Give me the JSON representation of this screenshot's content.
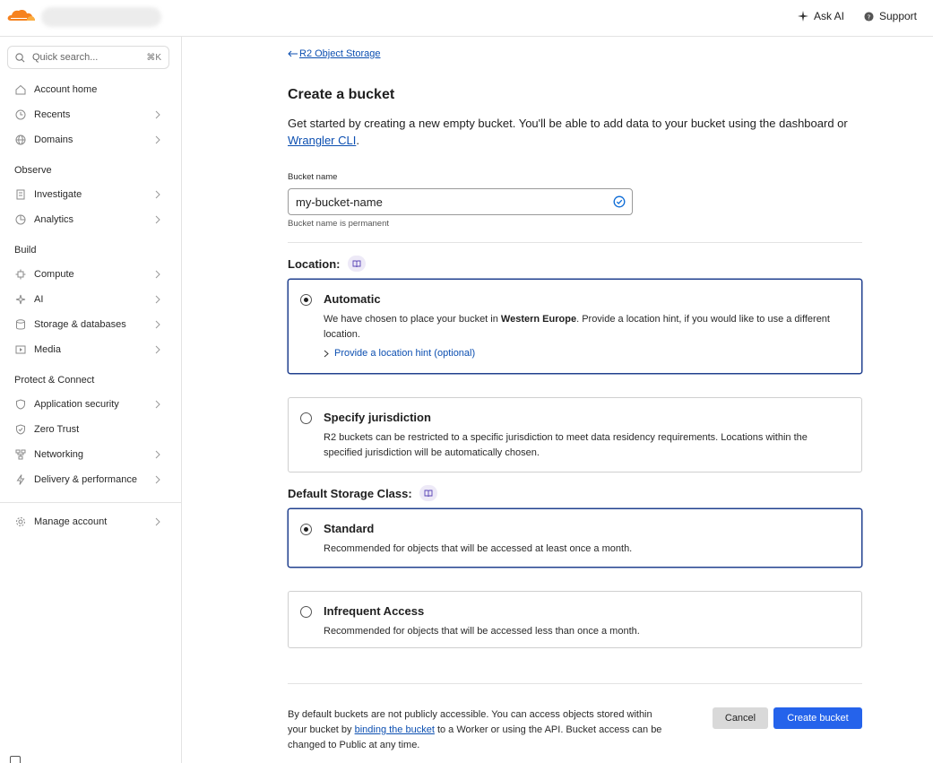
{
  "topbar": {
    "ask_ai_label": "Ask AI",
    "support_label": "Support"
  },
  "sidebar": {
    "search_placeholder": "Quick search...",
    "search_shortcut": "⌘K",
    "items_top": [
      {
        "label": "Account home",
        "icon": "home-icon"
      },
      {
        "label": "Recents",
        "icon": "clock-icon"
      },
      {
        "label": "Domains",
        "icon": "globe-icon"
      }
    ],
    "section_observe": "Observe",
    "items_observe": [
      {
        "label": "Investigate",
        "icon": "document-search-icon"
      },
      {
        "label": "Analytics",
        "icon": "pie-chart-icon"
      }
    ],
    "section_build": "Build",
    "items_build": [
      {
        "label": "Compute",
        "icon": "chip-icon"
      },
      {
        "label": "AI",
        "icon": "sparkle-icon"
      },
      {
        "label": "Storage & databases",
        "icon": "database-icon"
      },
      {
        "label": "Media",
        "icon": "media-icon"
      }
    ],
    "section_protect": "Protect & Connect",
    "items_protect": [
      {
        "label": "Application security",
        "icon": "shield-icon"
      },
      {
        "label": "Zero Trust",
        "icon": "shield-check-icon"
      },
      {
        "label": "Networking",
        "icon": "network-icon"
      },
      {
        "label": "Delivery & performance",
        "icon": "lightning-icon"
      }
    ],
    "manage_account": "Manage account"
  },
  "main": {
    "back_link": "R2 Object Storage",
    "title": "Create a bucket",
    "intro_text": "Get started by creating a new empty bucket. You'll be able to add data to your bucket using the dashboard or ",
    "intro_link": "Wrangler CLI",
    "intro_end": ".",
    "bucket_name_label": "Bucket name",
    "bucket_name_value": "my-bucket-name",
    "bucket_name_help": "Bucket name is permanent",
    "location_label": "Location:",
    "location_options": [
      {
        "title": "Automatic",
        "desc_pre": "We have chosen to place your bucket in ",
        "desc_bold": "Western Europe",
        "desc_post": ". Provide a location hint, if you would like to use a different location.",
        "hint_link": "Provide a location hint (optional)",
        "selected": true
      },
      {
        "title": "Specify jurisdiction",
        "desc": "R2 buckets can be restricted to a specific jurisdiction to meet data residency requirements. Locations within the specified jurisdiction will be automatically chosen.",
        "selected": false
      }
    ],
    "storage_label": "Default Storage Class:",
    "storage_options": [
      {
        "title": "Standard",
        "desc": "Recommended for objects that will be accessed at least once a month.",
        "selected": true
      },
      {
        "title": "Infrequent Access",
        "desc": "Recommended for objects that will be accessed less than once a month.",
        "selected": false
      }
    ],
    "footer_pre": "By default buckets are not publicly accessible. You can access objects stored within your bucket by ",
    "footer_link": "binding the bucket",
    "footer_post": " to a Worker or using the API. Bucket access can be changed to Public at any time.",
    "cancel_label": "Cancel",
    "create_label": "Create bucket"
  },
  "colors": {
    "accent": "#2563eb",
    "link": "#0c4fb1",
    "selected_border": "#22418f",
    "brand_orange": "#f6821f"
  }
}
